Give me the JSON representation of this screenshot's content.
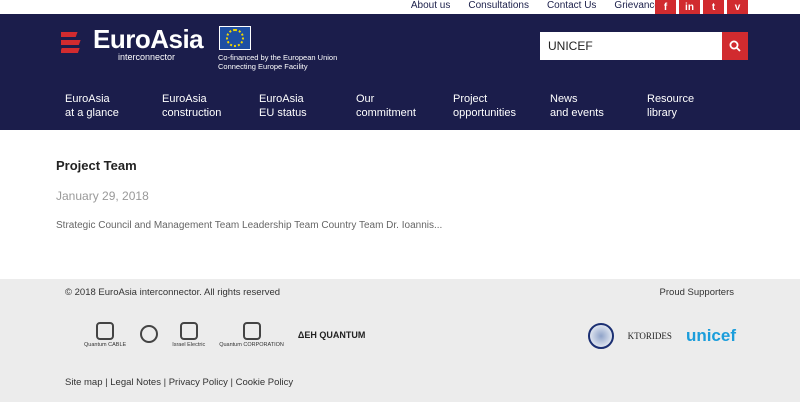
{
  "top_links": [
    "About us",
    "Consultations",
    "Contact Us",
    "Grievance"
  ],
  "social": [
    {
      "icon": "facebook-icon",
      "glyph": "f"
    },
    {
      "icon": "linkedin-icon",
      "glyph": "in"
    },
    {
      "icon": "twitter-icon",
      "glyph": "t"
    },
    {
      "icon": "vimeo-icon",
      "glyph": "v"
    }
  ],
  "logo": {
    "name": "EuroAsia",
    "sub": "interconnector"
  },
  "eu": {
    "line1": "Co-financed by the European Union",
    "line2": "Connecting Europe Facility"
  },
  "search": {
    "value": "UNICEF"
  },
  "nav": [
    {
      "line1": "EuroAsia",
      "line2": "at a glance"
    },
    {
      "line1": "EuroAsia",
      "line2": "construction"
    },
    {
      "line1": "EuroAsia",
      "line2": "EU status"
    },
    {
      "line1": "Our",
      "line2": "commitment"
    },
    {
      "line1": "Project",
      "line2": "opportunities"
    },
    {
      "line1": "News",
      "line2": "and events"
    },
    {
      "line1": "Resource",
      "line2": "library"
    }
  ],
  "post": {
    "title": "Project Team",
    "date": "January 29, 2018",
    "excerpt": "Strategic Council and Management Team Leadership Team Country Team Dr. Ioannis..."
  },
  "footer": {
    "copyright": "© 2018 EuroAsia interconnector. All rights reserved",
    "supporters_label": "Proud Supporters",
    "partners": [
      "Quantum CABLE",
      "Israel Electric",
      "Quantum CORPORATION"
    ],
    "deh": "ΔΕΗ QUANTUM",
    "ktorides": "KTORIDES",
    "unicef": "unicef",
    "links": [
      "Site map",
      "Legal Notes",
      "Privacy Policy",
      "Cookie Policy"
    ]
  },
  "colors": {
    "navy": "#1b1d4b",
    "accent_red": "#d12b2f",
    "unicef_blue": "#1b9ddb"
  }
}
